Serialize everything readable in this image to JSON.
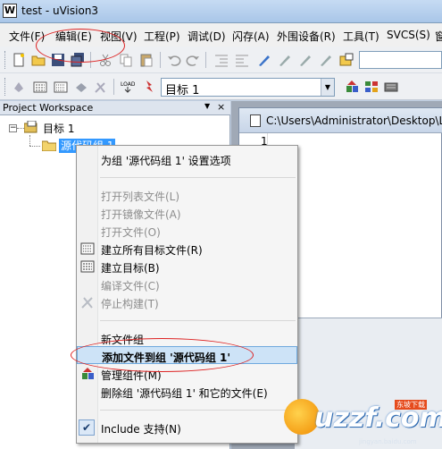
{
  "window": {
    "title": "test  - uVision3",
    "icon_letter": "W"
  },
  "menubar": {
    "items": [
      "文件(F)",
      "编辑(E)",
      "视图(V)",
      "工程(P)",
      "调试(D)",
      "闪存(A)",
      "外围设备(R)",
      "工具(T)",
      "SVCS(S)",
      "窗"
    ]
  },
  "toolbar": {
    "target_select": "目标 1"
  },
  "workspace": {
    "title": "Project Workspace",
    "pin": "▼",
    "close": "×",
    "tree": {
      "expander": "−",
      "target": "目标 1",
      "group": "源代码组 1"
    }
  },
  "editor": {
    "path": "C:\\Users\\Administrator\\Desktop\\L",
    "line_number": "1"
  },
  "context_menu": {
    "options": "为组 '源代码组 1' 设置选项",
    "open_list": "打开列表文件(L)",
    "open_image": "打开镜像文件(A)",
    "open_file": "打开文件(O)",
    "build_all": "建立所有目标文件(R)",
    "build_target": "建立目标(B)",
    "compile": "编译文件(C)",
    "stop_build": "停止构建(T)",
    "new_group": "新文件组",
    "add_files": "添加文件到组 '源代码组 1'",
    "manage": "管理组件(M)",
    "delete_group": "删除组 '源代码组 1' 和它的文件(E)",
    "include_deps": "Include 支持(N)",
    "include_checked": "✔"
  },
  "watermark": {
    "brand": "uzzf.com",
    "tag": "东坡下载",
    "url": "jingyan.baidu.com"
  },
  "colors": {
    "selection": "#3399ff",
    "highlight": "#cde3f7",
    "annotation": "#dd2222"
  }
}
